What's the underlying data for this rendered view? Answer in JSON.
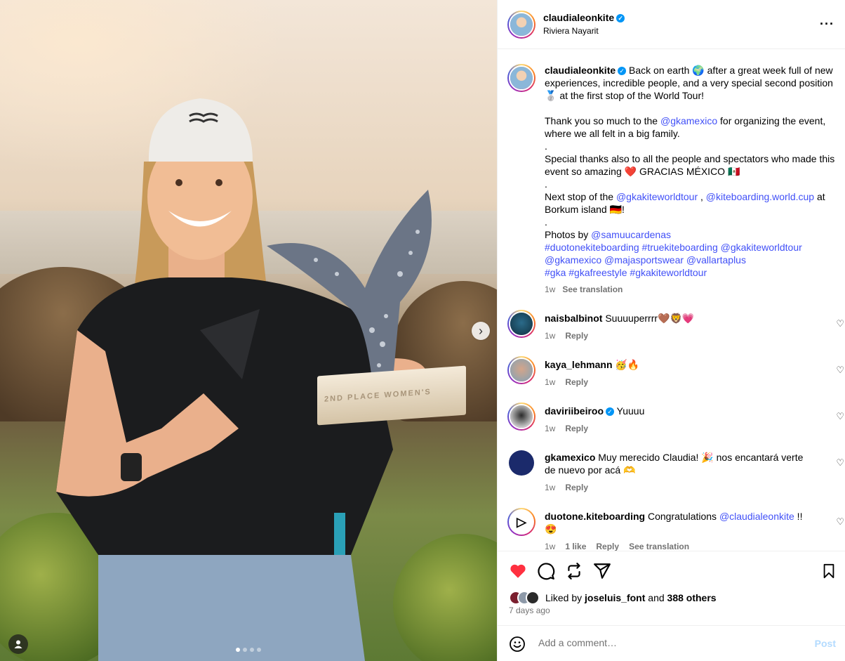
{
  "post": {
    "username": "claudialeonkite",
    "location": "Riviera Nayarit",
    "more_icon": "more-horizontal-icon",
    "trophy_text": "2ND PLACE WOMEN'S",
    "carousel": {
      "slides": 4,
      "active": 1
    }
  },
  "caption": {
    "username": "claudialeonkite",
    "p1": "Back on earth 🌍 after a great week full of new experiences, incredible people, and a very special second position 🥈 at the first stop of the World Tour!",
    "p2_pre": "Thank you so much to the ",
    "p2_mention": "@gkamexico",
    "p2_post": " for organizing the event, where we all felt in a big family.",
    "dot1": ".",
    "p3": "Special thanks also to all the people and spectators who made this event so amazing ❤️ GRACIAS MÉXICO 🇲🇽",
    "dot2": ".",
    "p4_pre": "Next stop of the ",
    "p4_m1": "@gkakiteworldtour",
    "p4_sep": " , ",
    "p4_m2": "@kiteboarding.world.cup",
    "p4_post": " at Borkum island 🇩🇪!",
    "dot3": ".",
    "p5_pre": "Photos by ",
    "p5_m1": "@samuucardenas",
    "tags1": "#duotonekiteboarding #truekiteboarding @gkakiteworldtour",
    "tags2": "@gkamexico @majasportswear @vallartaplus",
    "tags3": "#gka #gkafreestyle #gkakiteworldtour",
    "time": "1w",
    "see_translation": "See translation"
  },
  "comments": [
    {
      "user": "naisbalbinot",
      "text": "Suuuuperrrr🤎🦁💗",
      "time": "1w",
      "reply": "Reply"
    },
    {
      "user": "kaya_lehmann",
      "text": "🥳🔥",
      "time": "1w",
      "reply": "Reply"
    },
    {
      "user": "daviriibeiroo",
      "text": "Yuuuu",
      "time": "1w",
      "reply": "Reply"
    },
    {
      "user": "gkamexico",
      "text": "Muy merecido Claudia! 🎉 nos encantará verte de nuevo por acá 🫶",
      "time": "1w",
      "reply": "Reply"
    },
    {
      "user": "duotone.kiteboarding",
      "text_pre": "Congratulations ",
      "mention": "@claudialeonkite",
      "text_post": " !! 😍",
      "time": "1w",
      "likes": "1 like",
      "reply": "Reply",
      "see_translation": "See translation"
    }
  ],
  "actions": {
    "liked_by_label": "Liked by",
    "liked_by_user": "joseluis_font",
    "and": "and",
    "others": "388 others",
    "date": "7 days ago"
  },
  "comment_bar": {
    "placeholder": "Add a comment…",
    "post_label": "Post"
  },
  "colors": {
    "like_red": "#ff3040",
    "link_blue": "#4150f7",
    "verified": "#0095f6"
  }
}
